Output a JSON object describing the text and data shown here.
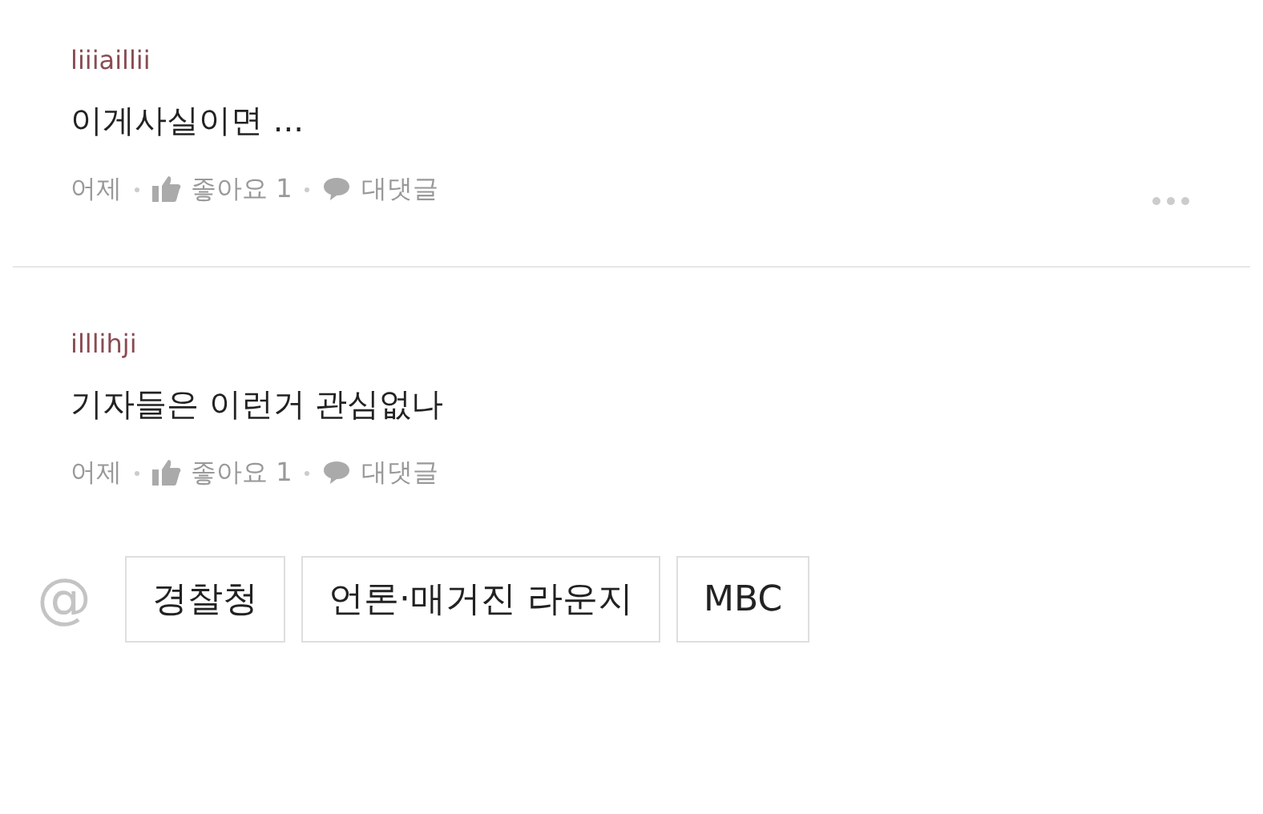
{
  "comments": [
    {
      "username": "liiiaillii",
      "text": "이게사실이면 ...",
      "time": "어제",
      "like_label": "좋아요 1",
      "reply_label": "대댓글",
      "has_menu": true
    },
    {
      "username": "illlihji",
      "text": "기자들은 이런거 관심없나",
      "time": "어제",
      "like_label": "좋아요 1",
      "reply_label": "대댓글",
      "has_menu": false
    }
  ],
  "tags": {
    "symbol": "@",
    "items": [
      "경찰청",
      "언론·매거진 라운지",
      "MBC"
    ]
  }
}
